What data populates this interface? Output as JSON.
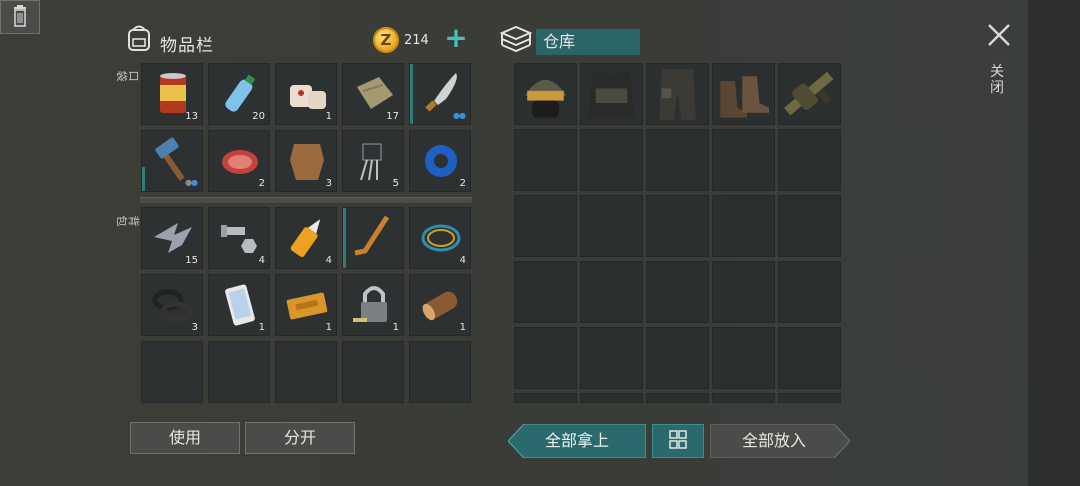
{
  "inventory": {
    "title": "物品栏",
    "coins": "214",
    "pocket_label": "口袋",
    "backpack_label": "背包",
    "pocket_items": [
      {
        "name": "canned-food",
        "count": "13"
      },
      {
        "name": "water-bottle",
        "count": "20"
      },
      {
        "name": "bandage",
        "count": "1"
      },
      {
        "name": "cloth",
        "count": "17"
      },
      {
        "name": "machete",
        "count": ""
      },
      {
        "name": "hammer",
        "count": ""
      },
      {
        "name": "raw-meat",
        "count": "2"
      },
      {
        "name": "leather",
        "count": "3"
      },
      {
        "name": "electronic-component",
        "count": "5"
      },
      {
        "name": "duct-tape",
        "count": "2"
      }
    ],
    "backpack_items": [
      {
        "name": "metal-scrap",
        "count": "15"
      },
      {
        "name": "nuts-and-bolts",
        "count": "4"
      },
      {
        "name": "glue",
        "count": "4"
      },
      {
        "name": "hockey-stick",
        "count": ""
      },
      {
        "name": "wire",
        "count": "4"
      },
      {
        "name": "rubber-rings",
        "count": "3"
      },
      {
        "name": "smartphone",
        "count": "1"
      },
      {
        "name": "coupon",
        "count": "1"
      },
      {
        "name": "padlock-and-key",
        "count": "1"
      },
      {
        "name": "wood-log",
        "count": "1"
      }
    ]
  },
  "warehouse": {
    "title": "仓库",
    "items": [
      {
        "name": "tactical-helmet"
      },
      {
        "name": "tactical-vest"
      },
      {
        "name": "tactical-pants"
      },
      {
        "name": "combat-boots"
      },
      {
        "name": "grenade-launcher"
      }
    ]
  },
  "buttons": {
    "use": "使用",
    "split": "分开",
    "take_all": "全部拿上",
    "put_all": "全部放入",
    "close": "关闭"
  },
  "icons": {
    "backpack": "backpack-icon",
    "coin": "coin-icon",
    "add": "plus-icon",
    "trash": "trash-icon",
    "warehouse": "stack-icon",
    "grid": "grid-icon",
    "close": "close-icon"
  },
  "colors": {
    "accent": "#45c1b4",
    "teal_fill": "#2a6a6c",
    "slot_bg": "#2e3131"
  }
}
